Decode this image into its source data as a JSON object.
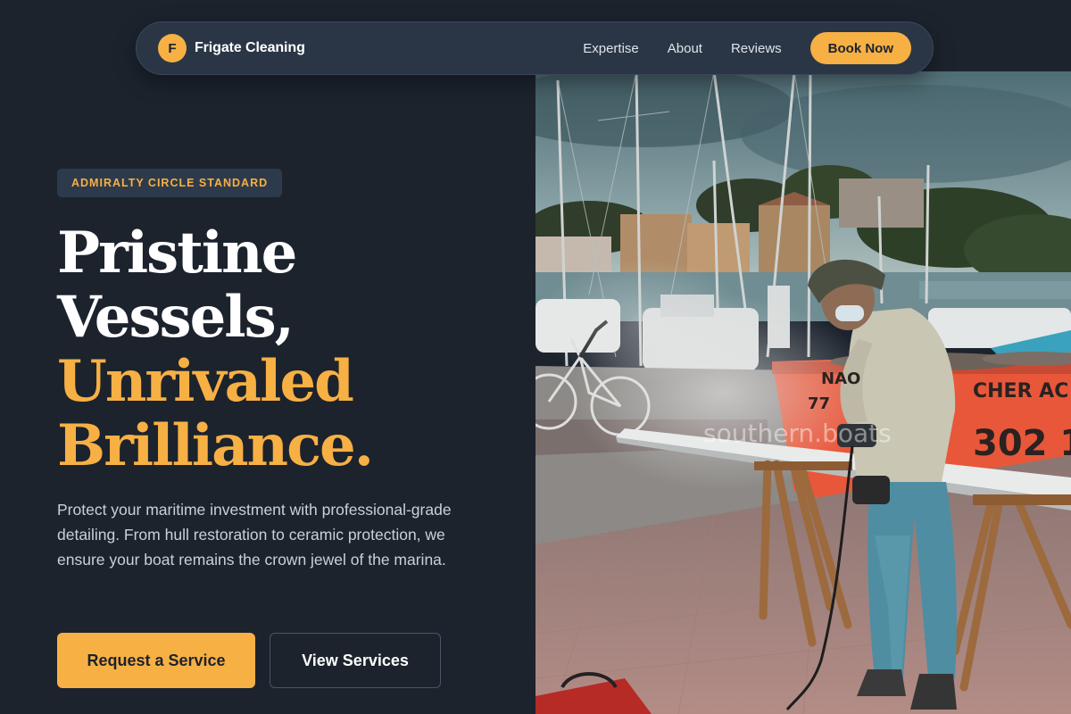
{
  "nav": {
    "brand_initial": "F",
    "brand_name": "Frigate Cleaning",
    "links": [
      "Expertise",
      "About",
      "Reviews"
    ],
    "cta": "Book Now"
  },
  "hero": {
    "badge": "ADMIRALTY CIRCLE STANDARD",
    "headline_lines": [
      "Pristine",
      "Vessels,"
    ],
    "headline_accent_lines": [
      "Unrivaled",
      "Brilliance."
    ],
    "lead": "Protect your maritime investment with professional-grade detailing. From hull restoration to ceramic protection, we ensure your boat remains the crown jewel of the marina.",
    "primary_cta": "Request a Service",
    "secondary_cta": "View Services"
  },
  "photo": {
    "watermark": "southern.boats",
    "skip_lettering": [
      "NAO",
      "77",
      "302 1",
      "CHER AC"
    ]
  },
  "colors": {
    "background": "#1c232d",
    "accent": "#f7b044",
    "nav_background": "#2a3646",
    "badge_background": "#2c3a4c"
  }
}
